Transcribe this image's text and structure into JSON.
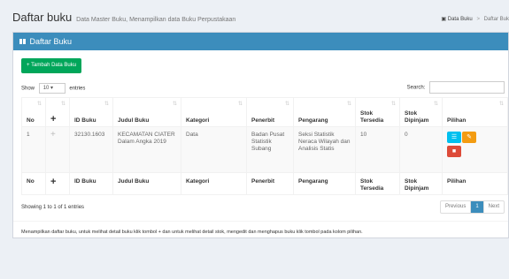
{
  "header": {
    "title": "Daftar buku",
    "subtitle": "Data Master Buku, Menampilkan data Buku Perpustakaan",
    "breadcrumb": [
      "Data Buku",
      "Daftar Buk"
    ]
  },
  "box": {
    "title": "Daftar Buku",
    "add_button": "+ Tambah Data Buku",
    "length": {
      "show": "Show",
      "value": "10",
      "entries": "entries"
    },
    "search_label": "Search:",
    "search_value": ""
  },
  "table": {
    "columns": [
      "No",
      "+",
      "ID Buku",
      "Judul Buku",
      "Kategori",
      "Penerbit",
      "Pengarang",
      "Stok Tersedia",
      "Stok Dipinjam",
      "Pilihan"
    ],
    "rows": [
      {
        "no": "1",
        "plus": "+",
        "id_buku": "32130.1603",
        "judul": "KECAMATAN CIATER Dalam Angka 2019",
        "kategori": "Data",
        "penerbit": "Badan Pusat Statistik Subang",
        "pengarang": "Seksi Statistik Neraca Wilayah dan Analisis Statis",
        "stok_tersedia": "10",
        "stok_dipinjam": "0",
        "actions": [
          "list-icon",
          "edit-icon",
          "trash-icon"
        ]
      }
    ]
  },
  "footer": {
    "info": "Showing 1 to 1 of 1 entries",
    "pagination": {
      "previous": "Previous",
      "current": "1",
      "next": "Next"
    }
  },
  "note": "Menampilkan daftar buku, untuk melihat detail buku klik tombol + dan untuk melihat detail stok, mengedit dan menghapus buku klik tombol pada kolom pilihan.",
  "colors": {
    "primary": "#3c8dbc",
    "success": "#00a65a",
    "info": "#00c0ef",
    "warning": "#f39c12",
    "danger": "#dd4b39"
  }
}
